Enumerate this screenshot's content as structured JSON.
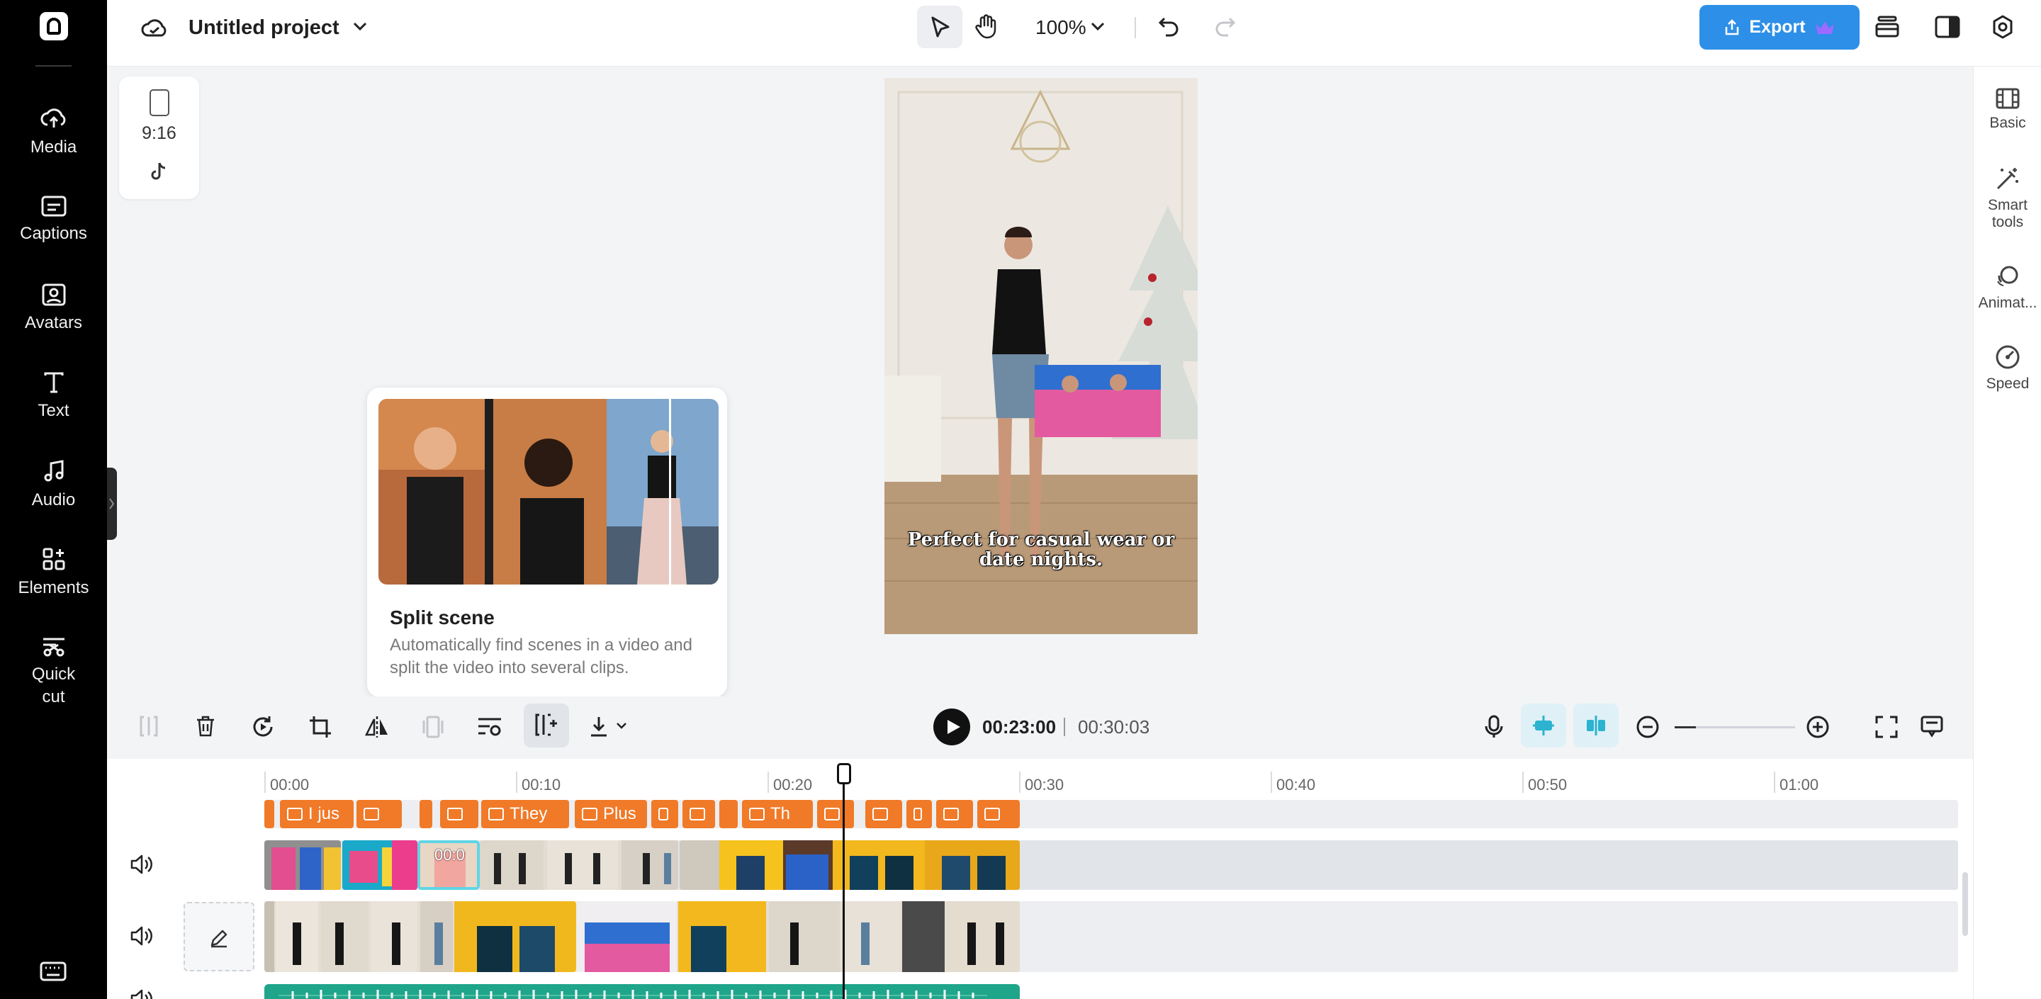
{
  "app": {
    "project_title": "Untitled project",
    "zoom_level": "100%",
    "export_label": "Export"
  },
  "left_rail": {
    "items": [
      {
        "label": "Media",
        "icon": "cloud-upload-icon"
      },
      {
        "label": "Captions",
        "icon": "captions-icon"
      },
      {
        "label": "Avatars",
        "icon": "avatar-icon"
      },
      {
        "label": "Text",
        "icon": "text-icon"
      },
      {
        "label": "Audio",
        "icon": "music-note-icon"
      },
      {
        "label": "Elements",
        "icon": "elements-icon"
      },
      {
        "label": "Quick\ncut",
        "icon": "quick-cut-icon"
      }
    ]
  },
  "right_rail": {
    "items": [
      {
        "label": "Basic",
        "icon": "film-icon"
      },
      {
        "label": "Smart\ntools",
        "icon": "magic-wand-icon"
      },
      {
        "label": "Animat...",
        "icon": "animation-icon"
      },
      {
        "label": "Speed",
        "icon": "speedometer-icon"
      }
    ]
  },
  "canvas": {
    "aspect_ratio": "9:16",
    "platform_icon": "tiktok-icon",
    "caption_text": "Perfect for casual wear or date nights."
  },
  "tooltip": {
    "title": "Split scene",
    "description": "Automatically find scenes in a video and split the video into several clips."
  },
  "playback": {
    "current_time": "00:23:00",
    "total_time": "00:30:03"
  },
  "timeline": {
    "ruler": [
      "00:00",
      "00:10",
      "00:20",
      "00:30",
      "00:40",
      "00:50",
      "01:00"
    ],
    "caption_clips": [
      "I jus",
      "",
      "",
      "",
      "They",
      "Plus",
      "",
      "",
      "",
      "Th",
      "",
      "",
      "",
      "",
      ""
    ],
    "selected_clip_time": "00:0",
    "playhead_position_seconds": 23
  },
  "colors": {
    "accent": "#2d8fe7",
    "caption_track": "#f07a28",
    "audio_track": "#1fa58a",
    "selection": "#5fd5e5"
  }
}
